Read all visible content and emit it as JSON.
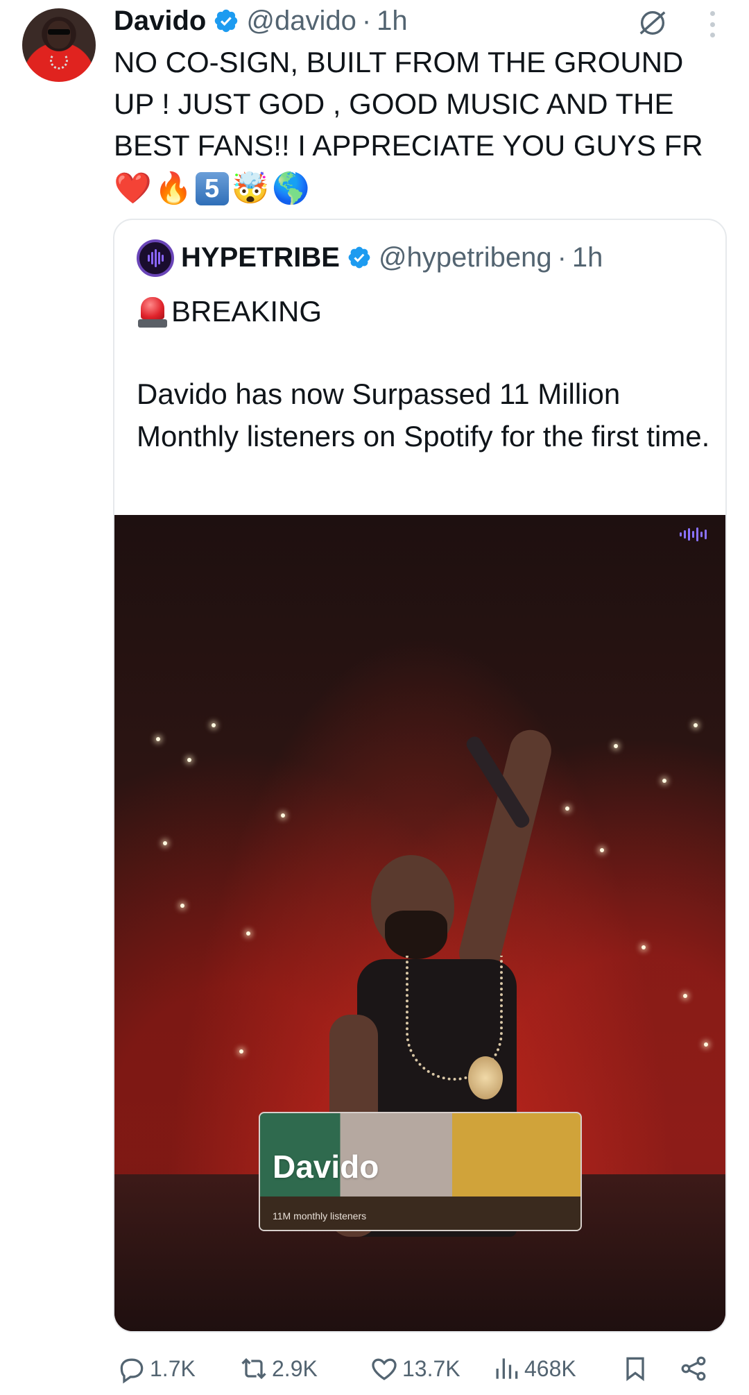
{
  "post": {
    "author_name": "Davido",
    "handle": "@davido",
    "separator": "·",
    "time": "1h",
    "text": "NO CO-SIGN, BUILT FROM THE GROUND UP ! JUST GOD , GOOD MUSIC AND THE BEST FANS!! I APPRECIATE YOU GUYS FR",
    "emojis": [
      "❤️",
      "🔥",
      "5",
      "🤯",
      "🌎"
    ]
  },
  "quote": {
    "author_name": "HYPETRIBE",
    "handle": "@hypetribeng",
    "separator": "·",
    "time": "1h",
    "headline": "BREAKING",
    "body": "Davido has now Surpassed 11 Million Monthly listeners on Spotify for the first time.",
    "media": {
      "card_artist": "Davido",
      "card_listeners": "11M monthly listeners"
    }
  },
  "actions": {
    "replies": "1.7K",
    "reposts": "2.9K",
    "likes": "13.7K",
    "views": "468K"
  },
  "colors": {
    "verified": "#1d9bf0",
    "text": "#0f1419",
    "secondary": "#536471"
  }
}
